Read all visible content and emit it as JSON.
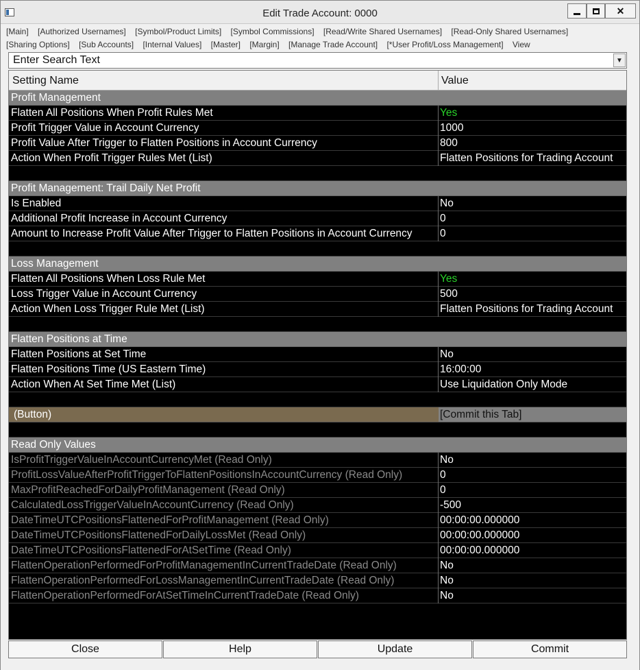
{
  "window": {
    "title": "Edit Trade Account: 0000"
  },
  "top_colors": [
    "#00c000",
    "#e00000"
  ],
  "tabs": [
    "[Main]",
    "[Authorized Usernames]",
    "[Symbol/Product Limits]",
    "[Symbol Commissions]",
    "[Read/Write Shared Usernames]",
    "[Read-Only Shared Usernames]",
    "[Sharing Options]",
    "[Sub Accounts]",
    "[Internal Values]",
    "[Master]",
    "[Margin]",
    "[Manage Trade Account]",
    "[*User Profit/Loss Management]",
    "View"
  ],
  "search": {
    "text": "Enter Search Text",
    "dropdown_icon": "chevron-down-icon"
  },
  "grid": {
    "headers": {
      "name": "Setting Name",
      "value": "Value"
    },
    "rows": [
      {
        "type": "section",
        "name": "Profit Management",
        "value": ""
      },
      {
        "type": "setting",
        "name": "Flatten All Positions When Profit Rules Met",
        "value": "Yes",
        "green": true
      },
      {
        "type": "setting",
        "name": "Profit Trigger Value in Account Currency",
        "value": "1000"
      },
      {
        "type": "setting",
        "name": "Profit Value After Trigger to Flatten Positions in Account Currency",
        "value": "800"
      },
      {
        "type": "setting",
        "name": "Action When Profit Trigger Rules Met (List)",
        "value": "Flatten Positions for Trading Account"
      },
      {
        "type": "blank",
        "name": "",
        "value": ""
      },
      {
        "type": "section",
        "name": "Profit Management: Trail Daily Net Profit",
        "value": ""
      },
      {
        "type": "setting",
        "name": "Is Enabled",
        "value": "No"
      },
      {
        "type": "setting",
        "name": "Additional Profit Increase in Account Currency",
        "value": "0"
      },
      {
        "type": "setting",
        "name": "Amount to Increase Profit Value After Trigger to Flatten Positions in Account Currency",
        "value": "0"
      },
      {
        "type": "blank",
        "name": "",
        "value": ""
      },
      {
        "type": "section",
        "name": "Loss Management",
        "value": ""
      },
      {
        "type": "setting",
        "name": "Flatten All Positions When Loss Rule Met",
        "value": "Yes",
        "green": true
      },
      {
        "type": "setting",
        "name": "Loss Trigger Value in Account Currency",
        "value": "500"
      },
      {
        "type": "setting",
        "name": "Action When Loss Trigger Rule Met (List)",
        "value": "Flatten Positions for Trading Account"
      },
      {
        "type": "blank",
        "name": "",
        "value": ""
      },
      {
        "type": "section",
        "name": "Flatten Positions at Time",
        "value": ""
      },
      {
        "type": "setting",
        "name": "Flatten Positions at Set Time",
        "value": "No"
      },
      {
        "type": "setting",
        "name": "Flatten Positions Time (US Eastern Time)",
        "value": "16:00:00"
      },
      {
        "type": "setting",
        "name": "Action When At Set Time Met (List)",
        "value": "Use Liquidation Only Mode"
      },
      {
        "type": "blank",
        "name": "",
        "value": ""
      },
      {
        "type": "button",
        "name": "(Button)",
        "value": "[Commit this Tab]"
      },
      {
        "type": "blank",
        "name": "",
        "value": ""
      },
      {
        "type": "section",
        "name": "Read Only Values",
        "value": ""
      },
      {
        "type": "readonly",
        "name": "IsProfitTriggerValueInAccountCurrencyMet (Read Only)",
        "value": "No"
      },
      {
        "type": "readonly",
        "name": "ProfitLossValueAfterProfitTriggerToFlattenPositionsInAccountCurrency (Read Only)",
        "value": "0"
      },
      {
        "type": "readonly",
        "name": "MaxProfitReachedForDailyProfitManagement (Read Only)",
        "value": "0"
      },
      {
        "type": "readonly",
        "name": "CalculatedLossTriggerValueInAccountCurrency (Read Only)",
        "value": "-500"
      },
      {
        "type": "readonly",
        "name": "DateTimeUTCPositionsFlattenedForProfitManagement (Read Only)",
        "value": "00:00:00.000000"
      },
      {
        "type": "readonly",
        "name": "DateTimeUTCPositionsFlattenedForDailyLossMet (Read Only)",
        "value": "00:00:00.000000"
      },
      {
        "type": "readonly",
        "name": "DateTimeUTCPositionsFlattenedForAtSetTime (Read Only)",
        "value": "00:00:00.000000"
      },
      {
        "type": "readonly",
        "name": "FlattenOperationPerformedForProfitManagementInCurrentTradeDate (Read Only)",
        "value": "No"
      },
      {
        "type": "readonly",
        "name": "FlattenOperationPerformedForLossManagementInCurrentTradeDate (Read Only)",
        "value": "No"
      },
      {
        "type": "readonly",
        "name": "FlattenOperationPerformedForAtSetTimeInCurrentTradeDate (Read Only)",
        "value": "No"
      }
    ]
  },
  "footer": {
    "buttons": [
      "Close",
      "Help",
      "Update",
      "Commit"
    ]
  }
}
